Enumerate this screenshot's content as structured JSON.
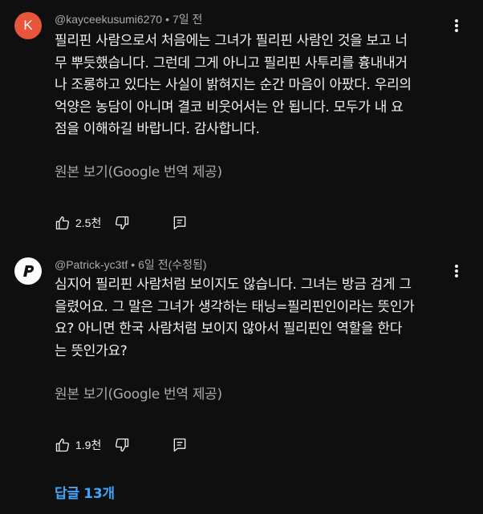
{
  "comments": [
    {
      "avatar_letter": "K",
      "avatar_color": "#e8553a",
      "author": "@kayceekusumi6270",
      "separator": "•",
      "time": "7일 전",
      "lines": [
        "필리핀 사람으로서 처음에는 그녀가 필리핀 사람인 것을 보고 너",
        "무 뿌듯했습니다. 그런데 그게 아니고 필리핀 사투리를 흉내내거",
        "나 조롱하고 있다는 사실이 밝혀지는 순간 마음이 아팠다. 우리의",
        "억양은 농담이 아니며 결코 비웃어서는 안 됩니다. 모두가 내 요",
        "점을 이해하길 바랍니다. 감사합니다."
      ],
      "translate_label": "원본 보기(Google 번역 제공)",
      "like_count": "2.5천",
      "icons": [
        "thumbs-up-icon",
        "thumbs-down-icon",
        "reply-icon",
        "more-vert-icon"
      ]
    },
    {
      "avatar_letter": "P",
      "avatar_color": "#ffffff",
      "author": "@Patrick-yc3tf",
      "separator": "•",
      "time": "6일 전(수정됨)",
      "lines": [
        "심지어 필리핀 사람처럼 보이지도 않습니다. 그녀는 방금 검게 그",
        "을렸어요. 그 말은 그녀가 생각하는 태닝=필리핀인이라는 뜻인가",
        "요? 아니면 한국 사람처럼 보이지 않아서 필리핀인 역할을 한다",
        "는 뜻인가요?"
      ],
      "translate_label": "원본 보기(Google 번역 제공)",
      "like_count": "1.9천",
      "icons": [
        "thumbs-up-icon",
        "thumbs-down-icon",
        "reply-icon",
        "more-vert-icon"
      ]
    }
  ],
  "replies_label": "답글 13개",
  "accent_color": "#3ea6ff"
}
